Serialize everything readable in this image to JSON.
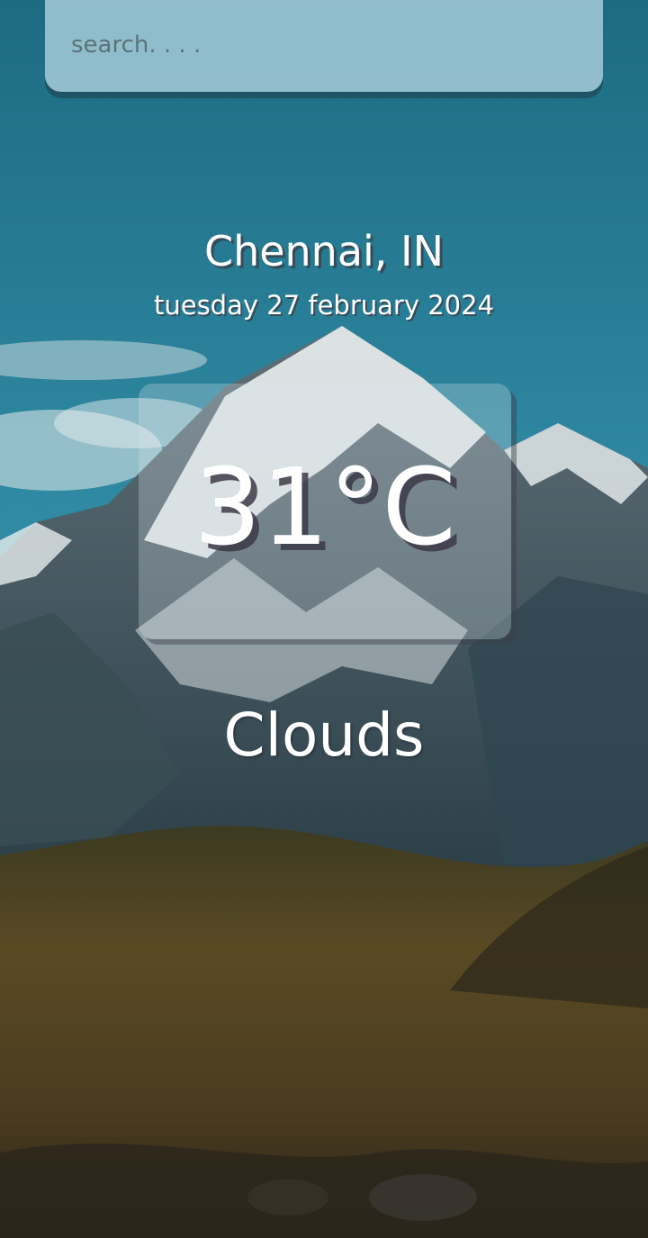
{
  "search": {
    "placeholder": "search. . . ."
  },
  "weather": {
    "location": "Chennai, IN",
    "date": "tuesday 27 february 2024",
    "temperature": "31°C",
    "condition": "Clouds"
  },
  "background": {
    "icon": "mountain-landscape-image"
  }
}
